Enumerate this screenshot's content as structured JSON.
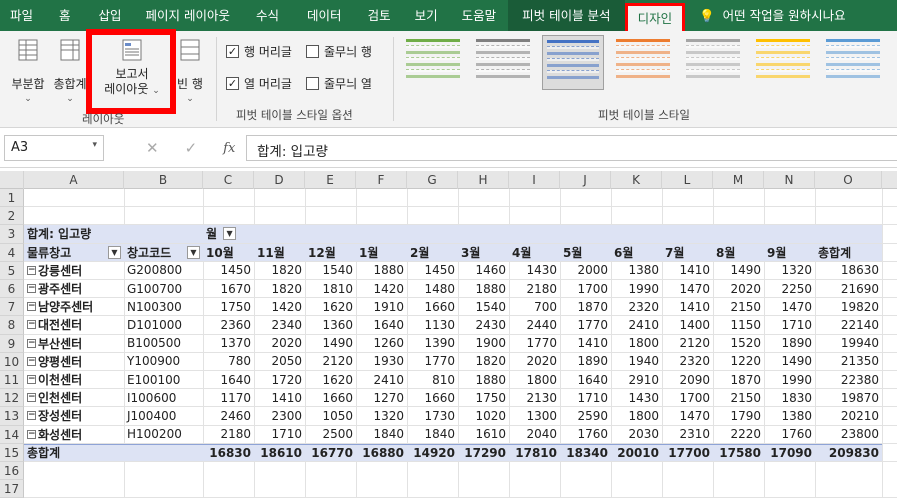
{
  "tabs": [
    "파일",
    "홈",
    "삽입",
    "페이지 레이아웃",
    "수식",
    "데이터",
    "검토",
    "보기",
    "도움말",
    "피벗 테이블 분석",
    "디자인"
  ],
  "help_text": "어떤 작업을 원하시나요",
  "ribbon": {
    "subtotal": "부분합",
    "grandtotal": "총합계",
    "report_layout_1": "보고서",
    "report_layout_2": "레이아웃",
    "blank_rows": "빈 행",
    "layout_group": "레이아웃",
    "opt_row_headers": "행 머리글",
    "opt_col_headers": "열 머리글",
    "opt_banded_rows": "줄무늬 행",
    "opt_banded_cols": "줄무늬 열",
    "options_group": "피벗 테이블 스타일 옵션",
    "styles_group": "피벗 테이블 스타일",
    "style_colors": [
      "#70ad47",
      "#808080",
      "#4472c4",
      "#ed7d31",
      "#a5a5a5",
      "#ffc000",
      "#5b9bd5"
    ]
  },
  "namebox": "A3",
  "formula": "합계: 입고량",
  "columns": [
    "A",
    "B",
    "C",
    "D",
    "E",
    "F",
    "G",
    "H",
    "I",
    "J",
    "K",
    "L",
    "M",
    "N",
    "O"
  ],
  "rows_idx": [
    "1",
    "2",
    "3",
    "4",
    "5",
    "6",
    "7",
    "8",
    "9",
    "10",
    "11",
    "12",
    "13",
    "14",
    "15",
    "16",
    "17"
  ],
  "pivot": {
    "value_label": "합계: 입고량",
    "col_field": "월",
    "row_field": "물류창고",
    "row_field2": "창고코드",
    "months": [
      "10월",
      "11월",
      "12월",
      "1월",
      "2월",
      "3월",
      "4월",
      "5월",
      "6월",
      "7월",
      "8월",
      "9월",
      "총합계"
    ],
    "data": [
      {
        "name": "강릉센터",
        "code": "G200800",
        "v": [
          "1450",
          "1820",
          "1540",
          "1880",
          "1450",
          "1460",
          "1430",
          "2000",
          "1380",
          "1410",
          "1490",
          "1320",
          "18630"
        ]
      },
      {
        "name": "광주센터",
        "code": "G100700",
        "v": [
          "1670",
          "1820",
          "1810",
          "1420",
          "1480",
          "1880",
          "2180",
          "1700",
          "1990",
          "1470",
          "2020",
          "2250",
          "21690"
        ]
      },
      {
        "name": "남양주센터",
        "code": "N100300",
        "v": [
          "1750",
          "1420",
          "1620",
          "1910",
          "1660",
          "1540",
          "700",
          "1870",
          "2320",
          "1410",
          "2150",
          "1470",
          "19820"
        ]
      },
      {
        "name": "대전센터",
        "code": "D101000",
        "v": [
          "2360",
          "2340",
          "1360",
          "1640",
          "1130",
          "2430",
          "2440",
          "1770",
          "2410",
          "1400",
          "1150",
          "1710",
          "22140"
        ]
      },
      {
        "name": "부산센터",
        "code": "B100500",
        "v": [
          "1370",
          "2020",
          "1490",
          "1260",
          "1390",
          "1900",
          "1770",
          "1410",
          "1800",
          "2120",
          "1520",
          "1890",
          "19940"
        ]
      },
      {
        "name": "양평센터",
        "code": "Y100900",
        "v": [
          "780",
          "2050",
          "2120",
          "1930",
          "1770",
          "1820",
          "2020",
          "1890",
          "1940",
          "2320",
          "1220",
          "1490",
          "21350"
        ]
      },
      {
        "name": "이천센터",
        "code": "E100100",
        "v": [
          "1640",
          "1720",
          "1620",
          "2410",
          "810",
          "1880",
          "1800",
          "1640",
          "2910",
          "2090",
          "1870",
          "1990",
          "22380"
        ]
      },
      {
        "name": "인천센터",
        "code": "I100600",
        "v": [
          "1170",
          "1410",
          "1660",
          "1270",
          "1660",
          "1750",
          "2130",
          "1710",
          "1430",
          "1700",
          "2150",
          "1830",
          "19870"
        ]
      },
      {
        "name": "장성센터",
        "code": "J100400",
        "v": [
          "2460",
          "2300",
          "1050",
          "1320",
          "1730",
          "1020",
          "1300",
          "2590",
          "1800",
          "1470",
          "1790",
          "1380",
          "20210"
        ]
      },
      {
        "name": "화성센터",
        "code": "H100200",
        "v": [
          "2180",
          "1710",
          "2500",
          "1840",
          "1840",
          "1610",
          "2040",
          "1760",
          "2030",
          "2310",
          "2220",
          "1760",
          "23800"
        ]
      }
    ],
    "total_label": "총합계",
    "totals": [
      "16830",
      "18610",
      "16770",
      "16880",
      "14920",
      "17290",
      "17810",
      "18340",
      "20010",
      "17700",
      "17580",
      "17090",
      "209830"
    ]
  }
}
